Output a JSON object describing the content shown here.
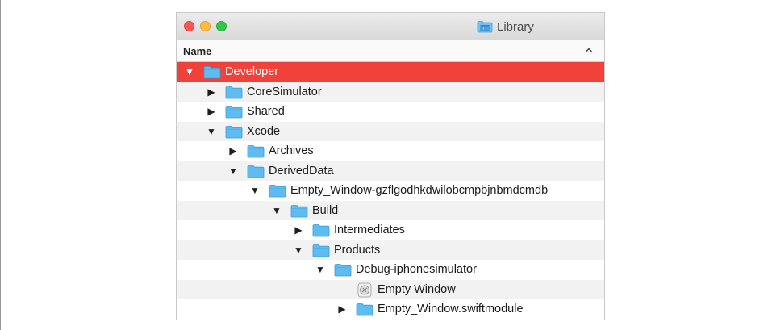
{
  "window": {
    "title": "Library"
  },
  "header": {
    "column_name": "Name",
    "sort_indicator": "^"
  },
  "rows": [
    {
      "name": "Developer",
      "level": 0,
      "disclosure": "▼",
      "icon": "folder-icon",
      "selected": true
    },
    {
      "name": "CoreSimulator",
      "level": 1,
      "disclosure": "▶",
      "icon": "folder-icon"
    },
    {
      "name": "Shared",
      "level": 1,
      "disclosure": "▶",
      "icon": "folder-icon"
    },
    {
      "name": "Xcode",
      "level": 1,
      "disclosure": "▼",
      "icon": "folder-icon"
    },
    {
      "name": "Archives",
      "level": 2,
      "disclosure": "▶",
      "icon": "folder-icon"
    },
    {
      "name": "DerivedData",
      "level": 2,
      "disclosure": "▼",
      "icon": "folder-icon"
    },
    {
      "name": "Empty_Window-gzflgodhkdwilobcmpbjnbmdcmdb",
      "level": 3,
      "disclosure": "▼",
      "icon": "folder-icon"
    },
    {
      "name": "Build",
      "level": 4,
      "disclosure": "▼",
      "icon": "folder-icon"
    },
    {
      "name": "Intermediates",
      "level": 5,
      "disclosure": "▶",
      "icon": "folder-icon"
    },
    {
      "name": "Products",
      "level": 5,
      "disclosure": "▼",
      "icon": "folder-icon"
    },
    {
      "name": "Debug-iphonesimulator",
      "level": 6,
      "disclosure": "▼",
      "icon": "folder-icon"
    },
    {
      "name": "Empty Window",
      "level": 7,
      "disclosure": "",
      "icon": "app-icon"
    },
    {
      "name": "Empty_Window.swiftmodule",
      "level": 7,
      "disclosure": "▶",
      "icon": "folder-icon"
    }
  ],
  "colors": {
    "selection": "#f1413b",
    "folder": "#5ebcf2"
  }
}
